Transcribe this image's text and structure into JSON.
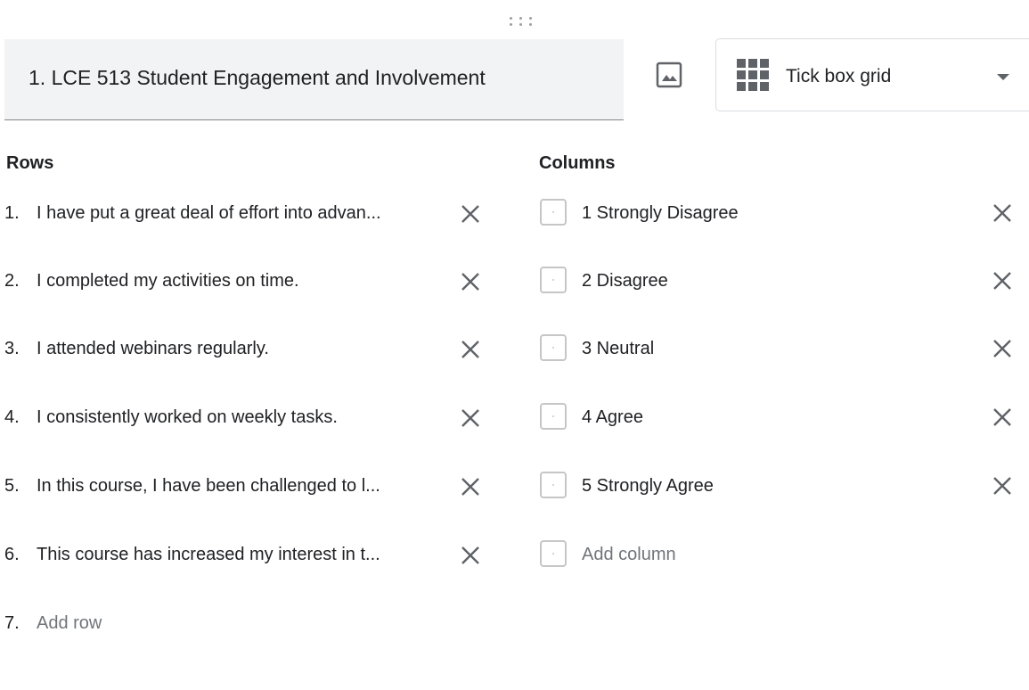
{
  "question": {
    "title": "1. LCE 513 Student Engagement and Involvement",
    "type_label": "Tick box grid",
    "type_icon": "grid-icon",
    "image_icon": "image-icon"
  },
  "rows_section": {
    "heading": "Rows",
    "items": [
      {
        "number": "1.",
        "text": "I have put a great deal of effort into advan..."
      },
      {
        "number": "2.",
        "text": "I completed my activities on time."
      },
      {
        "number": "3.",
        "text": "I attended webinars regularly."
      },
      {
        "number": "4.",
        "text": "I consistently worked on weekly tasks."
      },
      {
        "number": "5.",
        "text": "In this course, I have been challenged to l..."
      },
      {
        "number": "6.",
        "text": "This course has increased my interest in t..."
      }
    ],
    "add": {
      "number": "7.",
      "text": "Add row"
    }
  },
  "columns_section": {
    "heading": "Columns",
    "items": [
      {
        "text": "1 Strongly Disagree"
      },
      {
        "text": "2 Disagree"
      },
      {
        "text": "3 Neutral"
      },
      {
        "text": "4 Agree"
      },
      {
        "text": "5 Strongly Agree"
      }
    ],
    "add": {
      "text": "Add column"
    }
  },
  "colors": {
    "text": "#202124",
    "placeholder": "#70757a",
    "icon": "#5f6368",
    "title_bg": "#f1f3f4",
    "border": "#dadce0"
  }
}
